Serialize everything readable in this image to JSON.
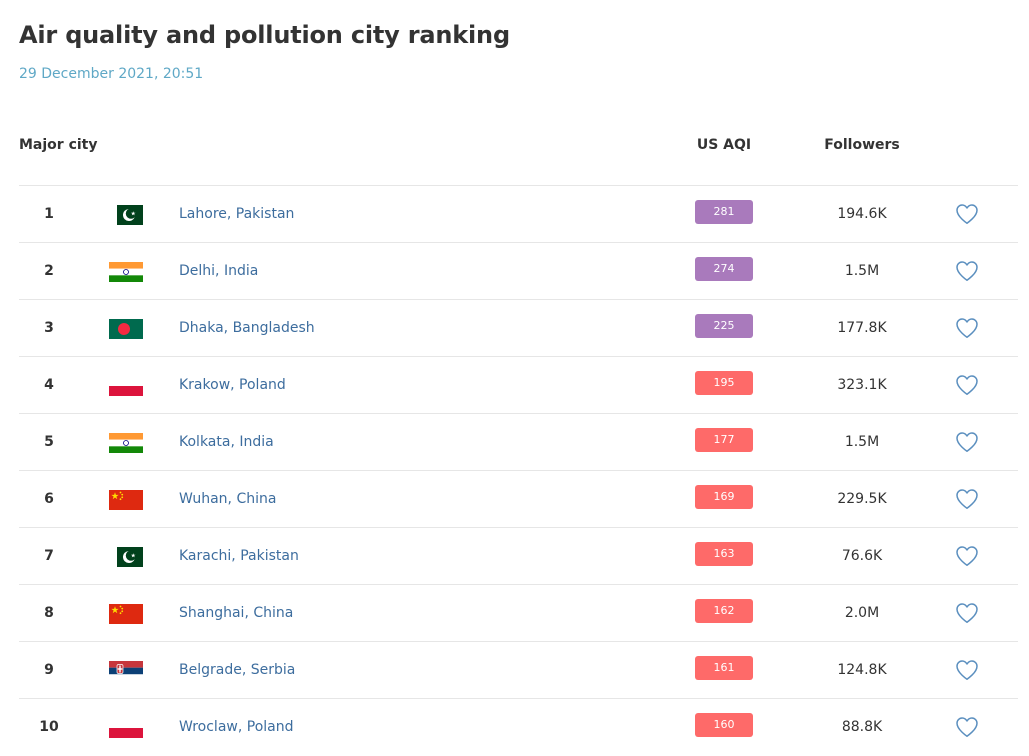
{
  "header": {
    "title": "Air quality and pollution city ranking",
    "timestamp": "29 December 2021, 20:51"
  },
  "table": {
    "columns": {
      "city": "Major city",
      "aqi": "US AQI",
      "followers": "Followers"
    },
    "rows": [
      {
        "rank": "1",
        "city": "Lahore, Pakistan",
        "country": "pakistan",
        "aqi": "281",
        "followers": "194.6K"
      },
      {
        "rank": "2",
        "city": "Delhi, India",
        "country": "india",
        "aqi": "274",
        "followers": "1.5M"
      },
      {
        "rank": "3",
        "city": "Dhaka, Bangladesh",
        "country": "bangladesh",
        "aqi": "225",
        "followers": "177.8K"
      },
      {
        "rank": "4",
        "city": "Krakow, Poland",
        "country": "poland",
        "aqi": "195",
        "followers": "323.1K"
      },
      {
        "rank": "5",
        "city": "Kolkata, India",
        "country": "india",
        "aqi": "177",
        "followers": "1.5M"
      },
      {
        "rank": "6",
        "city": "Wuhan, China",
        "country": "china",
        "aqi": "169",
        "followers": "229.5K"
      },
      {
        "rank": "7",
        "city": "Karachi, Pakistan",
        "country": "pakistan",
        "aqi": "163",
        "followers": "76.6K"
      },
      {
        "rank": "8",
        "city": "Shanghai, China",
        "country": "china",
        "aqi": "162",
        "followers": "2.0M"
      },
      {
        "rank": "9",
        "city": "Belgrade, Serbia",
        "country": "serbia",
        "aqi": "161",
        "followers": "124.8K"
      },
      {
        "rank": "10",
        "city": "Wroclaw, Poland",
        "country": "poland",
        "aqi": "160",
        "followers": "88.8K"
      }
    ]
  },
  "colors": {
    "very_unhealthy": "#a97abc",
    "unhealthy": "#fe6a69",
    "title": "#333333",
    "timestamp": "#5fa8c6",
    "link": "#3d6d9e",
    "heart": "#5b8fbf"
  },
  "icons": {
    "favorite": "heart-outline-icon"
  }
}
